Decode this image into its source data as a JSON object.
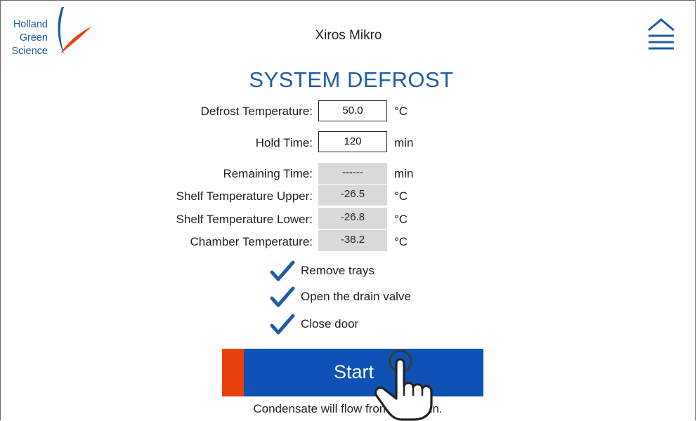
{
  "header": {
    "logo_lines": [
      "Holland",
      "Green",
      "Science"
    ],
    "app_title": "Xiros Mikro",
    "menu_icon": "chevron-up-menu-icon"
  },
  "page_title": "SYSTEM DEFROST",
  "settings": [
    {
      "label": "Defrost Temperature:",
      "value": "50.0",
      "unit": "°C"
    },
    {
      "label": "Hold Time:",
      "value": "120",
      "unit": "min"
    }
  ],
  "readouts": [
    {
      "label": "Remaining Time:",
      "value": "------",
      "unit": "min"
    },
    {
      "label": "Shelf Temperature Upper:",
      "value": "-26.5",
      "unit": "°C"
    },
    {
      "label": "Shelf Temperature Lower:",
      "value": "-26.8",
      "unit": "°C"
    },
    {
      "label": "Chamber Temperature:",
      "value": "-38.2",
      "unit": "°C"
    }
  ],
  "checklist": [
    {
      "label": "Remove trays",
      "checked": true
    },
    {
      "label": "Open the drain valve",
      "checked": true
    },
    {
      "label": "Close door",
      "checked": true
    }
  ],
  "start_button": {
    "label": "Start"
  },
  "hint_text": "Condensate will flow from the drain.",
  "colors": {
    "brand_blue": "#1f5ba8",
    "button_blue": "#0f52b5",
    "accent_orange": "#e8400c",
    "readonly_gray": "#d9d9d9"
  }
}
